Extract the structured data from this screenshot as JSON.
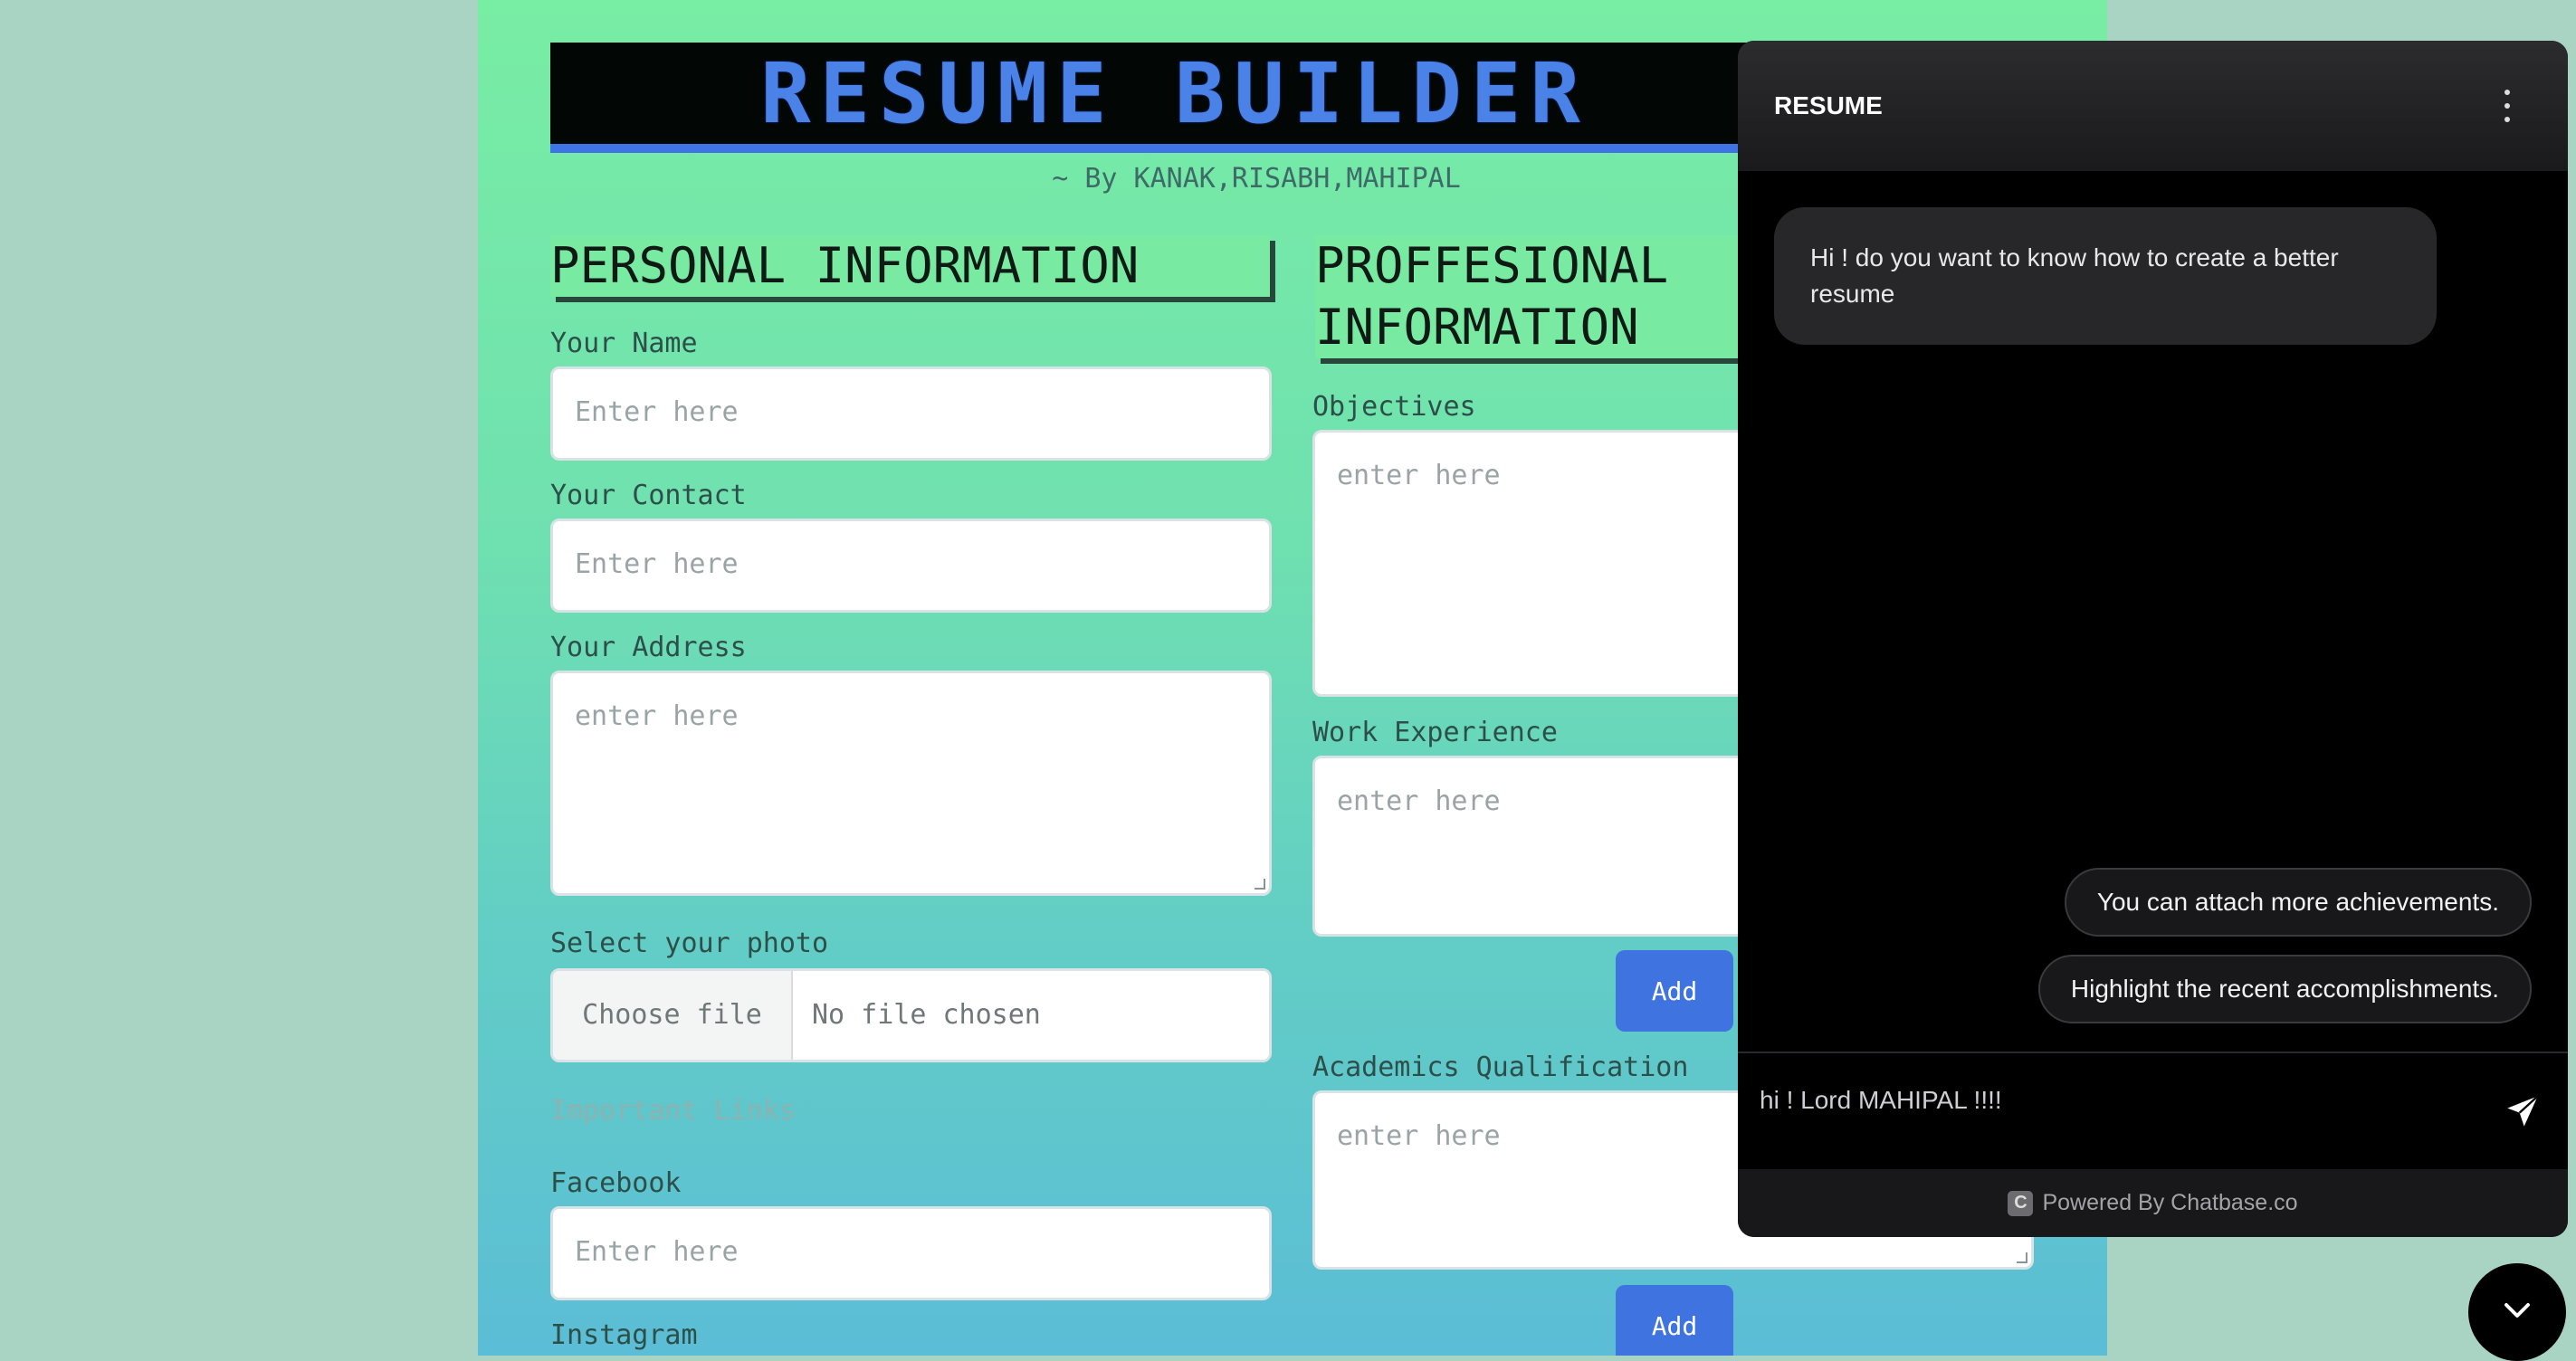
{
  "header": {
    "title": "RESUME BUILDER",
    "byline": "~ By KANAK,RISABH,MAHIPAL"
  },
  "personal": {
    "section_title": "PERSONAL INFORMATION",
    "name_label": "Your Name",
    "name_placeholder": "Enter here",
    "contact_label": "Your Contact",
    "contact_placeholder": "Enter here",
    "address_label": "Your Address",
    "address_placeholder": "enter here",
    "photo_label": "Select your photo",
    "file_button": "Choose file",
    "file_status": "No file chosen",
    "links_label": "Important Links",
    "facebook_label": "Facebook",
    "facebook_placeholder": "Enter here",
    "instagram_label": "Instagram"
  },
  "professional": {
    "section_title_line1": "PROFFESIONAL",
    "section_title_line2": "INFORMATION",
    "objectives_label": "Objectives",
    "objectives_placeholder": "enter here",
    "work_label": "Work Experience",
    "work_placeholder": "enter here",
    "add_label": "Add",
    "academics_label": "Academics Qualification",
    "academics_placeholder": "enter here",
    "add2_label": "Add"
  },
  "chat": {
    "title": "RESUME",
    "bot_message": "Hi ! do you want to know how to create a better resume",
    "suggestions": [
      "You can attach more achievements.",
      "Highlight the recent accomplishments."
    ],
    "input_value": "hi ! Lord MAHIPAL !!!!",
    "footer_logo": "C",
    "footer": "Powered By Chatbase.co"
  },
  "icons": {
    "menu": "kebab-menu-icon",
    "send": "paper-plane-send-icon",
    "toggle": "chevron-down-icon"
  },
  "colors": {
    "accent": "#3e73e0",
    "banner_bg": "#020605",
    "chat_bg": "#000000"
  }
}
